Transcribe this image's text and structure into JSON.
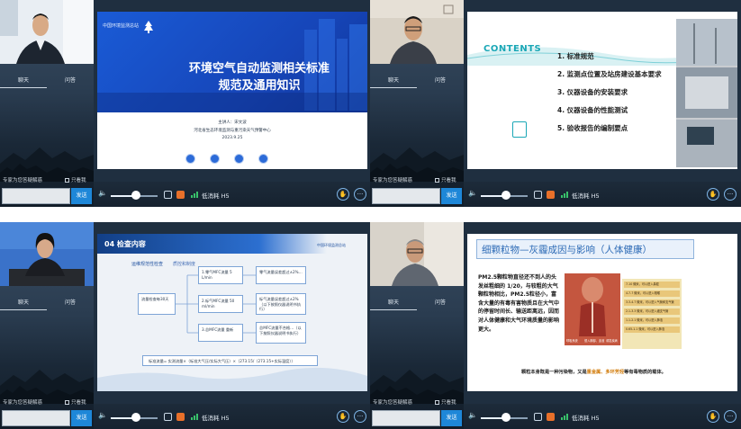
{
  "common": {
    "chat_tab": "聊天",
    "qa_tab": "问答",
    "chat_hint": "专家为您答疑解惑",
    "only_mine": "只看我",
    "send_label": "发送",
    "quality_label": "低消耗 H5",
    "volume_level": 0.55,
    "colors": {
      "send": "#1e87d8",
      "accent_orange": "#e8702a",
      "signal_green": "#39c36b"
    }
  },
  "panels": [
    {
      "slide": {
        "org_logo": "中国环境监测总站",
        "title_line1": "环境空气自动监测相关标准",
        "title_line2": "规范及通用知识",
        "speaker": "主讲人：宋文波",
        "organization": "河北省生态环境监测与重污染天气预警中心",
        "date": "2023.9.25"
      }
    },
    {
      "slide": {
        "contents_label": "CONTENTS",
        "items": [
          "1. 标准规范",
          "2. 监测点位置及站房建设基本要求",
          "3. 仪器设备的安装要求",
          "4. 仪器设备的性能测试",
          "5. 验收报告的编制要点"
        ]
      }
    },
    {
      "slide": {
        "section": "04  检查内容",
        "subtitle": "运维规范性检查",
        "subtitle2": "质控和制度",
        "org_logo": "中国环境监测总站",
        "boxes": [
          "流量检查每30天",
          "1.零气MFC流量 5 L/min",
          "2.标气MFC流量 50 ml/min",
          "3.总MFC流量 重新",
          "零气流量误差超过±2%…",
          "标气流量误差超过±2%（以下按照仪器说明书执行）",
          "总MFC流量不合格…（以下按照仪器说明书执行）"
        ],
        "formula": "标准流量= 实测流量×（标准大气压/实际大气压）×（273.15/（273.15+实际温度））"
      }
    },
    {
      "slide": {
        "title": "细颗粒物—灰霾成因与影响（人体健康）",
        "body": "PM2.5颗粒物直径还不到人的头发丝粗细的 1/20，与较粗的大气颗粒物相比，PM2.5粒径小，富含大量的有毒有害物质且在大气中的停留时间长、输送距离远，因而对人体健康和大气环境质量的影响更大。",
        "legend": [
          "7-10 微米，可以进入鼻腔",
          "4.7-7 微米，可以进入咽喉",
          "3.3-4.7 微米，可以进入气管和支气管",
          "2.1-3.3 微米，可以进入细支气管",
          "1.1-2.1 微米，可以进入肺泡",
          "0.65-1.1 微米，可以进入肺泡"
        ],
        "figure_labels": [
          "呼吸系统",
          "侵入肺部、血液",
          "诱发疾病"
        ],
        "caption_pre": "颗粒本身既是一种污染物，又是",
        "caption_hl": "重金属、多环芳烃",
        "caption_post": "等有毒物质的载体。"
      }
    }
  ]
}
